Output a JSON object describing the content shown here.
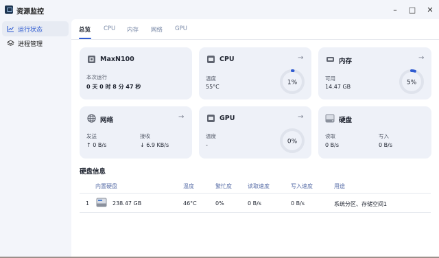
{
  "window": {
    "title": "资源监控",
    "icon": "monitor-app-icon",
    "controls": {
      "minimize": "–",
      "maximize": "□",
      "close": "✕"
    }
  },
  "sidebar": {
    "items": [
      {
        "label": "运行状态",
        "icon": "chart-line-icon",
        "active": true
      },
      {
        "label": "进程管理",
        "icon": "layers-icon",
        "active": false
      }
    ]
  },
  "tabs": [
    {
      "label": "总览",
      "active": true
    },
    {
      "label": "CPU",
      "active": false
    },
    {
      "label": "内存",
      "active": false
    },
    {
      "label": "网络",
      "active": false
    },
    {
      "label": "GPU",
      "active": false
    }
  ],
  "cards": {
    "system": {
      "title": "MaxN100",
      "uptime_label": "本次运行",
      "uptime_value": "0 天 0 时 8 分 47 秒"
    },
    "cpu": {
      "title": "CPU",
      "temp_label": "温度",
      "temp_value": "55°C",
      "usage_text": "1%",
      "usage_percent": 1
    },
    "memory": {
      "title": "内存",
      "available_label": "可用",
      "available_value": "14.47 GB",
      "usage_text": "5%",
      "usage_percent": 5
    },
    "network": {
      "title": "网络",
      "send_label": "发送",
      "send_value": "↑ 0 B/s",
      "recv_label": "接收",
      "recv_value": "↓ 6.9 KB/s"
    },
    "gpu": {
      "title": "GPU",
      "temp_label": "温度",
      "temp_value": "-",
      "usage_text": "0%",
      "usage_percent": 0
    },
    "disk": {
      "title": "硬盘",
      "read_label": "读取",
      "read_value": "0 B/s",
      "write_label": "写入",
      "write_value": "0 B/s"
    }
  },
  "disk_info": {
    "heading": "硬盘信息",
    "columns": [
      "内置硬盘",
      "温度",
      "繁忙度",
      "读取速度",
      "写入速度",
      "用途"
    ],
    "rows": [
      {
        "index": "1",
        "capacity": "238.47 GB",
        "temp": "46°C",
        "busy": "0%",
        "read": "0 B/s",
        "write": "0 B/s",
        "usage": "系统分区、存储空间1"
      }
    ]
  },
  "colors": {
    "accent": "#2f5bd1",
    "gauge_track": "#dfe3ec",
    "card_bg": "#eef1f8"
  }
}
